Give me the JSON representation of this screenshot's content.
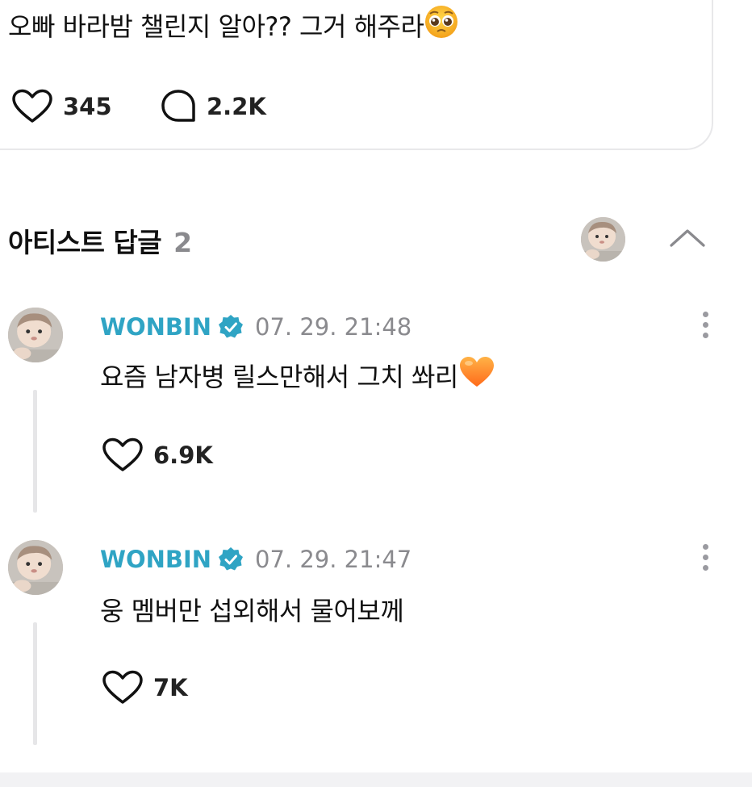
{
  "post": {
    "text": "오빠 바라밤 챌린지 알아?? 그거 해주라",
    "emoji_icon": "pleading-face-icon",
    "likes": "345",
    "comments": "2.2K"
  },
  "artist_replies": {
    "title": "아티스트 답글",
    "count": "2",
    "collapse_icon": "chevron-up-icon",
    "replies": [
      {
        "author": "WONBIN",
        "date": "07. 29. 21:48",
        "text": "요즘 남자병 릴스만해서 그치 쏴리",
        "emoji_icon": "orange-heart-icon",
        "likes": "6.9K"
      },
      {
        "author": "WONBIN",
        "date": "07. 29. 21:47",
        "text": "웅 멤버만 섭외해서 물어보께",
        "likes": "7K"
      }
    ]
  },
  "colors": {
    "accent": "#2fa4c4",
    "muted": "#8a8a8e",
    "divider": "#e6e6e8"
  }
}
